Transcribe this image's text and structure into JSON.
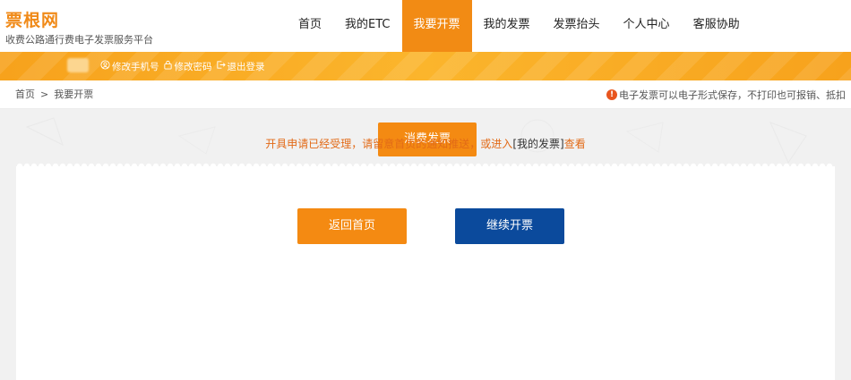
{
  "logo": {
    "title": "票根网",
    "subtitle": "收费公路通行费电子发票服务平台"
  },
  "nav": {
    "items": [
      {
        "label": "首页"
      },
      {
        "label": "我的ETC"
      },
      {
        "label": "我要开票",
        "active": true
      },
      {
        "label": "我的发票"
      },
      {
        "label": "发票抬头"
      },
      {
        "label": "个人中心"
      },
      {
        "label": "客服协助"
      }
    ]
  },
  "userbar": {
    "change_phone": "修改手机号",
    "change_password": "修改密码",
    "logout": "退出登录"
  },
  "breadcrumb": {
    "home": "首页",
    "separator": ">",
    "current": "我要开票"
  },
  "notice": {
    "text": "电子发票可以电子形式保存，不打印也可报销、抵扣"
  },
  "main": {
    "tab_label": "消费发票",
    "message_prefix": "开具申请已经受理，请留意首页的通知推送，或进入",
    "message_link": "[我的发票]",
    "message_suffix": "查看",
    "home_button": "返回首页",
    "continue_button": "继续开票"
  },
  "colors": {
    "accent_orange": "#f48a12",
    "button_blue": "#0b4a9c",
    "message_orange": "#e26a17",
    "warn_red": "#e8551e"
  },
  "icons": {
    "change_phone": "user-circle-icon",
    "change_password": "lock-icon",
    "logout": "logout-icon",
    "notice": "exclamation-circle-icon"
  }
}
